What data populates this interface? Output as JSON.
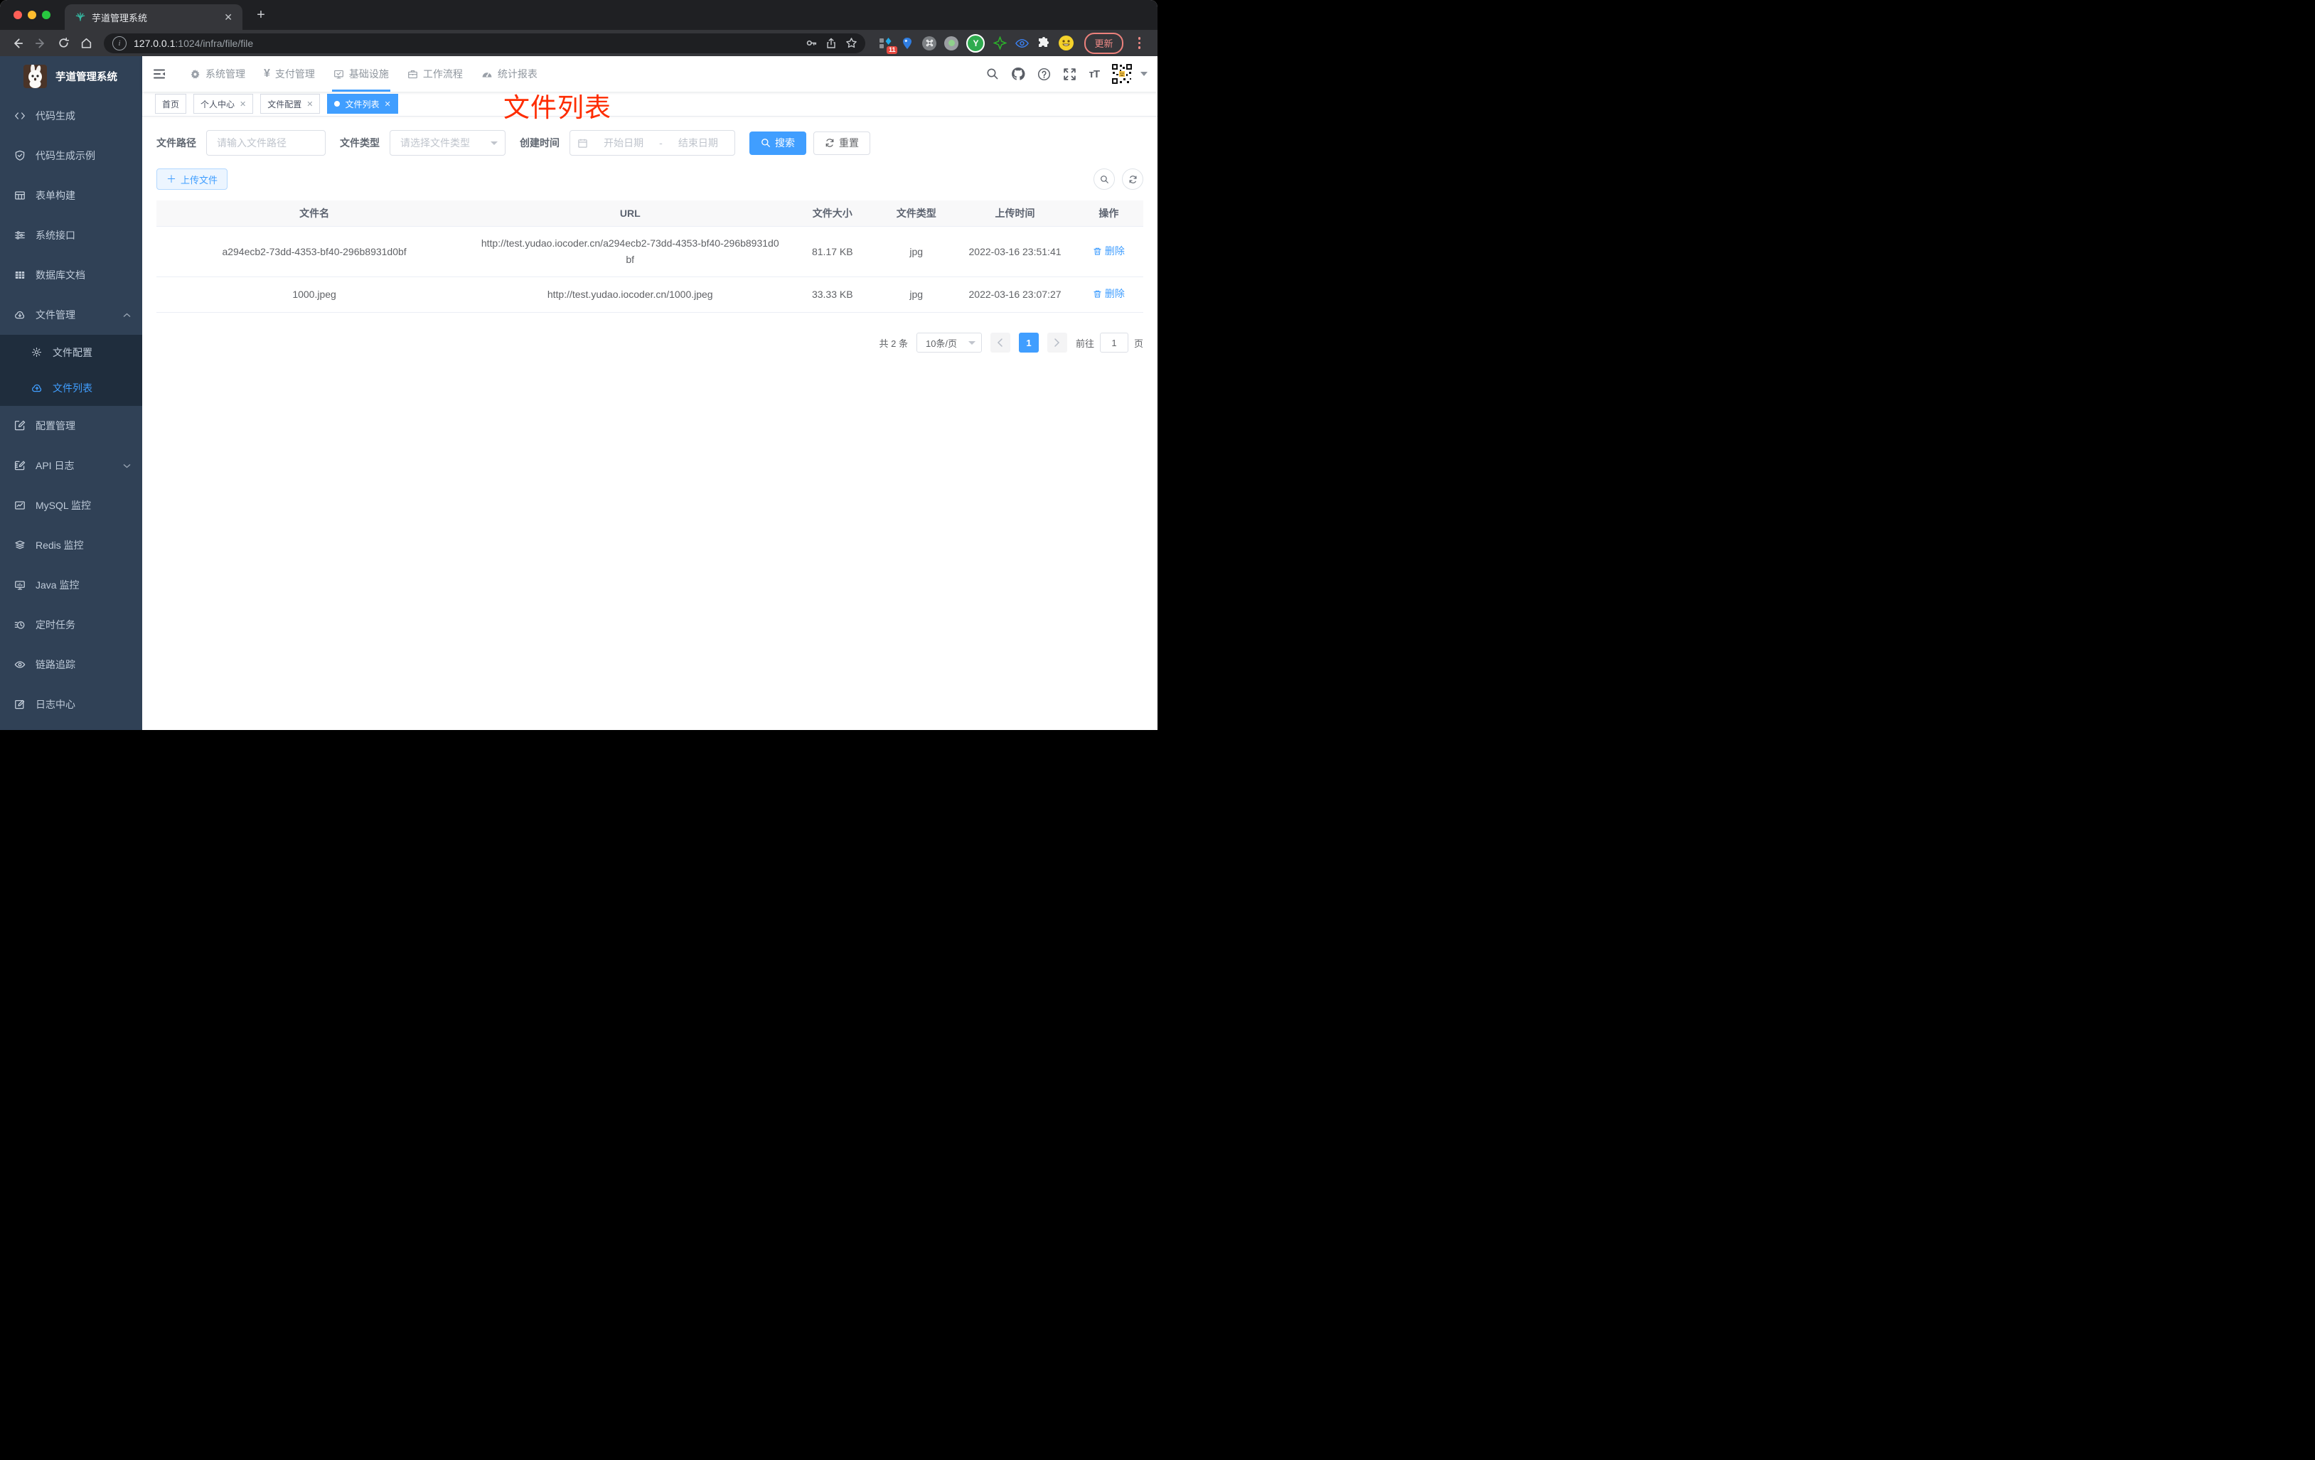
{
  "browser": {
    "tab_title": "芋道管理系统",
    "url_host": "127.0.0.1",
    "url_rest": ":1024/infra/file/file",
    "extensions_badge": "11",
    "update_label": "更新"
  },
  "sidebar": {
    "title": "芋道管理系统",
    "items": [
      {
        "label": "代码生成"
      },
      {
        "label": "代码生成示例"
      },
      {
        "label": "表单构建"
      },
      {
        "label": "系统接口"
      },
      {
        "label": "数据库文档"
      },
      {
        "label": "文件管理",
        "expanded": true,
        "children": [
          {
            "label": "文件配置"
          },
          {
            "label": "文件列表",
            "active": true
          }
        ]
      },
      {
        "label": "配置管理"
      },
      {
        "label": "API 日志"
      },
      {
        "label": "MySQL 监控"
      },
      {
        "label": "Redis 监控"
      },
      {
        "label": "Java 监控"
      },
      {
        "label": "定时任务"
      },
      {
        "label": "链路追踪"
      },
      {
        "label": "日志中心"
      }
    ]
  },
  "navbar": {
    "menus": [
      {
        "label": "系统管理"
      },
      {
        "label": "支付管理"
      },
      {
        "label": "基础设施",
        "active": true
      },
      {
        "label": "工作流程"
      },
      {
        "label": "统计报表"
      }
    ]
  },
  "tags": [
    {
      "label": "首页",
      "closable": false
    },
    {
      "label": "个人中心",
      "closable": true
    },
    {
      "label": "文件配置",
      "closable": true
    },
    {
      "label": "文件列表",
      "closable": true,
      "active": true
    }
  ],
  "annotation": "文件列表",
  "filters": {
    "path_label": "文件路径",
    "path_placeholder": "请输入文件路径",
    "type_label": "文件类型",
    "type_placeholder": "请选择文件类型",
    "date_label": "创建时间",
    "date_start": "开始日期",
    "date_separator": "-",
    "date_end": "结束日期",
    "search_label": "搜索",
    "reset_label": "重置"
  },
  "toolbar": {
    "upload_label": "上传文件"
  },
  "table": {
    "columns": [
      "文件名",
      "URL",
      "文件大小",
      "文件类型",
      "上传时间",
      "操作"
    ],
    "rows": [
      {
        "name": "a294ecb2-73dd-4353-bf40-296b8931d0bf",
        "url": "http://test.yudao.iocoder.cn/a294ecb2-73dd-4353-bf40-296b8931d0bf",
        "size": "81.17 KB",
        "type": "jpg",
        "time": "2022-03-16 23:51:41",
        "action": "删除"
      },
      {
        "name": "1000.jpeg",
        "url": "http://test.yudao.iocoder.cn/1000.jpeg",
        "size": "33.33 KB",
        "type": "jpg",
        "time": "2022-03-16 23:07:27",
        "action": "删除"
      }
    ]
  },
  "pagination": {
    "total": "共 2 条",
    "page_size": "10条/页",
    "current_page": "1",
    "goto_label": "前往",
    "goto_value": "1",
    "page_unit": "页"
  },
  "colors": {
    "primary": "#409eff",
    "annotation_red": "#fe2c00",
    "sidebar_bg": "#304156",
    "submenu_bg": "#1f2d3d"
  }
}
